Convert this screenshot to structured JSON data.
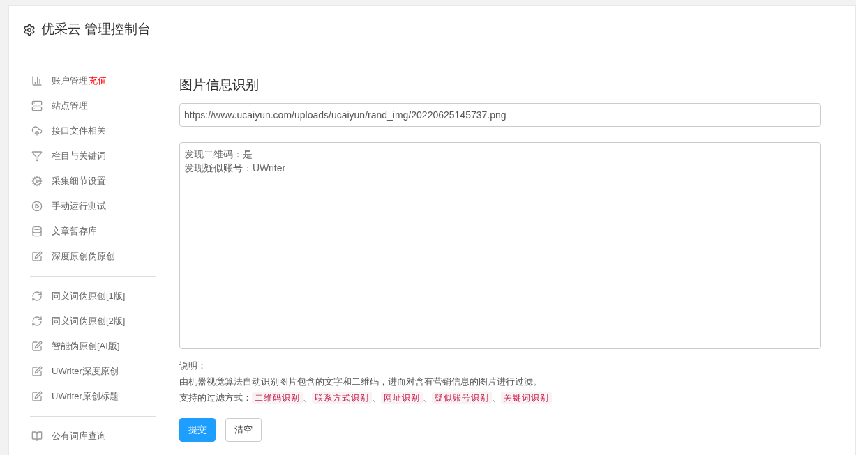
{
  "header": {
    "title": "优采云 管理控制台"
  },
  "sidebar": {
    "groups": [
      {
        "items": [
          {
            "kind": "stats",
            "label": "账户管理",
            "badge": "充值"
          },
          {
            "kind": "sites",
            "label": "站点管理"
          },
          {
            "kind": "upload",
            "label": "接口文件相关"
          },
          {
            "kind": "filter",
            "label": "栏目与关键词"
          },
          {
            "kind": "settings",
            "label": "采集细节设置"
          },
          {
            "kind": "run",
            "label": "手动运行测试"
          },
          {
            "kind": "storage",
            "label": "文章暂存库"
          },
          {
            "kind": "rewrite",
            "label": "深度原创伪原创"
          }
        ]
      },
      {
        "items": [
          {
            "kind": "synonym",
            "label": "同义词伪原创[1版]"
          },
          {
            "kind": "synonym",
            "label": "同义词伪原创[2版]"
          },
          {
            "kind": "rewrite",
            "label": "智能伪原创[AI版]"
          },
          {
            "kind": "rewrite",
            "label": "UWriter深度原创"
          },
          {
            "kind": "rewrite",
            "label": "UWriter原创标题"
          }
        ]
      },
      {
        "items": [
          {
            "kind": "dictionary",
            "label": "公有词库查询"
          }
        ]
      }
    ]
  },
  "main": {
    "title": "图片信息识别",
    "url_field": {
      "value": "https://www.ucaiyun.com/uploads/ucaiyun/rand_img/20220625145737.png"
    },
    "result_box": {
      "lines": [
        "发现二维码：是",
        "发现疑似账号：UWriter"
      ]
    },
    "note_label": "说明：",
    "note_text": "由机器视觉算法自动识别图片包含的文字和二维码，进而对含有营销信息的图片进行过滤。",
    "methods_label": "支持的过滤方式：",
    "methods": [
      "二维码识别",
      "联系方式识别",
      "网址识别",
      "疑似账号识别",
      "关键词识别"
    ],
    "separator": "、",
    "buttons": [
      {
        "label": "提交",
        "kind": "primary"
      },
      {
        "label": "清空",
        "kind": "default"
      }
    ]
  }
}
